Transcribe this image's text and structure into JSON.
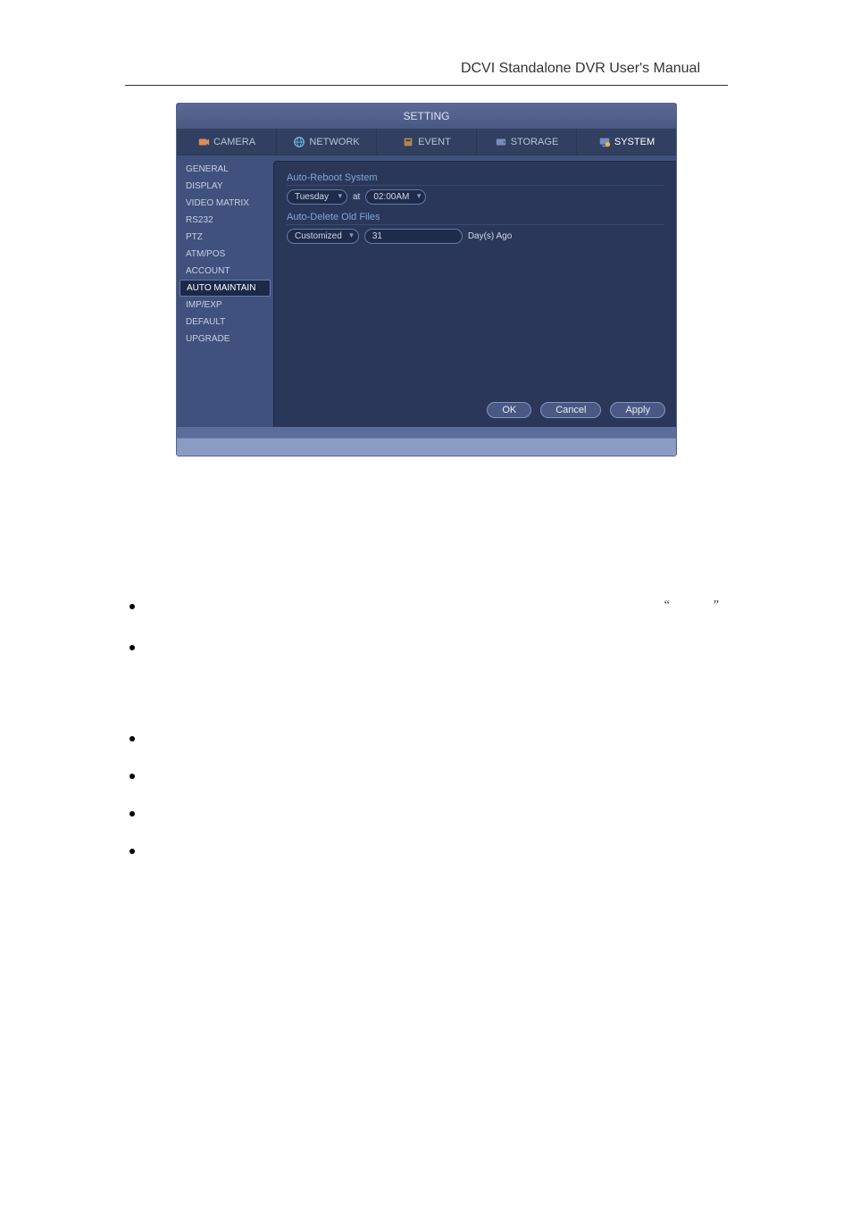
{
  "header": {
    "title": "DCVI Standalone DVR User's Manual"
  },
  "window": {
    "title": "SETTING",
    "tabs": [
      {
        "label": "CAMERA"
      },
      {
        "label": "NETWORK"
      },
      {
        "label": "EVENT"
      },
      {
        "label": "STORAGE"
      },
      {
        "label": "SYSTEM"
      }
    ],
    "sidebar": [
      "GENERAL",
      "DISPLAY",
      "VIDEO MATRIX",
      "RS232",
      "PTZ",
      "ATM/POS",
      "ACCOUNT",
      "AUTO MAINTAIN",
      "IMP/EXP",
      "DEFAULT",
      "UPGRADE"
    ],
    "sidebar_active": "AUTO MAINTAIN",
    "content": {
      "section1": "Auto-Reboot System",
      "reboot_day": "Tuesday",
      "at_label": "at",
      "reboot_time": "02:00AM",
      "section2": "Auto-Delete Old Files",
      "delete_mode": "Customized",
      "delete_days": "31",
      "days_ago_label": "Day(s) Ago"
    },
    "buttons": {
      "ok": "OK",
      "cancel": "Cancel",
      "apply": "Apply"
    }
  },
  "quotes": {
    "open": "“",
    "close": "”"
  }
}
